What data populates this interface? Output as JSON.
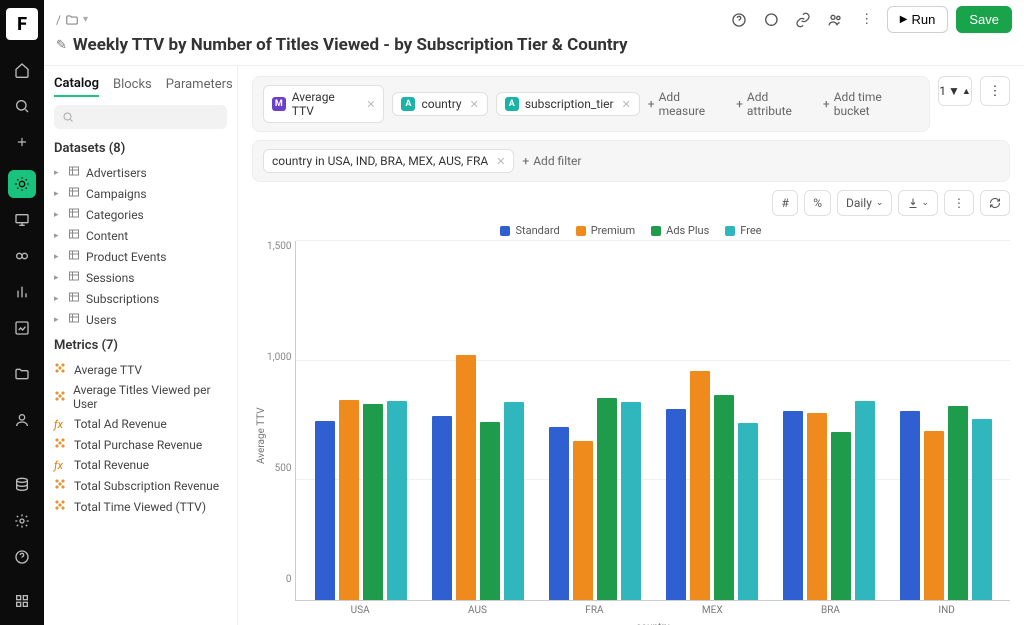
{
  "breadcrumb": {
    "root": "/",
    "folder_icon": "folder"
  },
  "title": "Weekly TTV by Number of Titles Viewed - by Subscription Tier & Country",
  "top_actions": {
    "run_label": "Run",
    "save_label": "Save"
  },
  "sidebar": {
    "tabs": [
      "Catalog",
      "Blocks",
      "Parameters"
    ],
    "active_tab": 0,
    "datasets_heading": "Datasets (8)",
    "datasets": [
      "Advertisers",
      "Campaigns",
      "Categories",
      "Content",
      "Product Events",
      "Sessions",
      "Subscriptions",
      "Users"
    ],
    "metrics_heading": "Metrics (7)",
    "metrics": [
      {
        "icon": "met",
        "name": "Average TTV"
      },
      {
        "icon": "met",
        "name": "Average Titles Viewed per User"
      },
      {
        "icon": "fx",
        "name": "Total Ad Revenue"
      },
      {
        "icon": "met",
        "name": "Total Purchase Revenue"
      },
      {
        "icon": "fx",
        "name": "Total Revenue"
      },
      {
        "icon": "met",
        "name": "Total Subscription Revenue"
      },
      {
        "icon": "met",
        "name": "Total Time Viewed (TTV)"
      }
    ]
  },
  "pills": {
    "measure": "Average TTV",
    "attr1": "country",
    "attr2": "subscription_tier",
    "add_measure": "Add measure",
    "add_attribute": "Add attribute",
    "add_time_bucket": "Add time bucket",
    "filter_count": "1"
  },
  "filter_row": {
    "filter_text": "country in USA, IND, BRA, MEX, AUS, FRA",
    "add_filter": "Add filter"
  },
  "chart_toolbar": {
    "granularity": "Daily"
  },
  "chart_data": {
    "type": "bar",
    "title": "",
    "xlabel": "country",
    "ylabel": "Average TTV",
    "ylim": [
      0,
      1500
    ],
    "yticks": [
      0,
      500,
      1000,
      1500
    ],
    "categories": [
      "USA",
      "AUS",
      "FRA",
      "MEX",
      "BRA",
      "IND"
    ],
    "series": [
      {
        "name": "Standard",
        "color": "#2f5fd0",
        "values": [
          750,
          770,
          725,
          800,
          790,
          790
        ]
      },
      {
        "name": "Premium",
        "color": "#ef8a1d",
        "values": [
          840,
          1025,
          665,
          960,
          785,
          710
        ]
      },
      {
        "name": "Ads Plus",
        "color": "#1f9b4c",
        "values": [
          820,
          745,
          845,
          860,
          705,
          815
        ]
      },
      {
        "name": "Free",
        "color": "#2fb7bd",
        "values": [
          835,
          830,
          830,
          740,
          835,
          760
        ]
      }
    ]
  }
}
